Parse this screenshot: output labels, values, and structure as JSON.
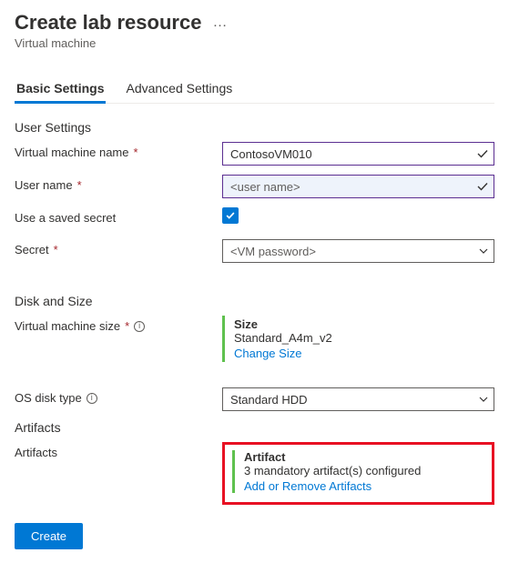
{
  "header": {
    "title": "Create lab resource",
    "subtitle": "Virtual machine"
  },
  "tabs": {
    "basic": "Basic Settings",
    "advanced": "Advanced Settings"
  },
  "sections": {
    "user_settings": "User Settings",
    "disk_size": "Disk and Size",
    "artifacts": "Artifacts"
  },
  "fields": {
    "vm_name": {
      "label": "Virtual machine name",
      "value": "ContosoVM010"
    },
    "user_name": {
      "label": "User name",
      "value": "<user name>"
    },
    "saved_secret": {
      "label": "Use a saved secret",
      "checked": true
    },
    "secret": {
      "label": "Secret",
      "value": "<VM password>"
    },
    "vm_size": {
      "label": "Virtual machine size",
      "heading": "Size",
      "value": "Standard_A4m_v2",
      "link": "Change Size"
    },
    "os_disk": {
      "label": "OS disk type",
      "value": "Standard HDD"
    },
    "artifacts": {
      "label": "Artifacts",
      "heading": "Artifact",
      "value": "3 mandatory artifact(s) configured",
      "link": "Add or Remove Artifacts"
    }
  },
  "footer": {
    "create": "Create"
  }
}
